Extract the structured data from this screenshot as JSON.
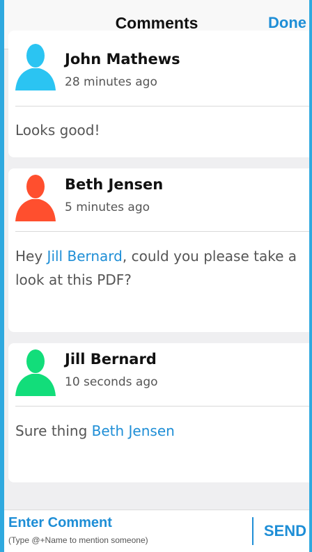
{
  "header": {
    "title": "Comments",
    "done_label": "Done"
  },
  "comments": [
    {
      "author": "John Mathews",
      "time": "28 minutes ago",
      "avatar_color": "#2bc4f2",
      "text_parts": [
        {
          "text": "Looks good!",
          "mention": false
        }
      ]
    },
    {
      "author": "Beth Jensen",
      "time": "5 minutes ago",
      "avatar_color": "#ff4f2e",
      "text_parts": [
        {
          "text": "Hey ",
          "mention": false
        },
        {
          "text": "Jill Bernard",
          "mention": true
        },
        {
          "text": ", could you please take a look at this PDF?",
          "mention": false
        }
      ]
    },
    {
      "author": "Jill Bernard",
      "time": "10 seconds ago",
      "avatar_color": "#12dd7a",
      "text_parts": [
        {
          "text": "Sure thing ",
          "mention": false
        },
        {
          "text": "Beth Jensen",
          "mention": true
        }
      ]
    }
  ],
  "composer": {
    "placeholder": "Enter Comment",
    "hint": "(Type @+Name to mention someone)",
    "send_label": "SEND"
  },
  "colors": {
    "accent": "#1e8ed6",
    "frame": "#2fa9df"
  }
}
